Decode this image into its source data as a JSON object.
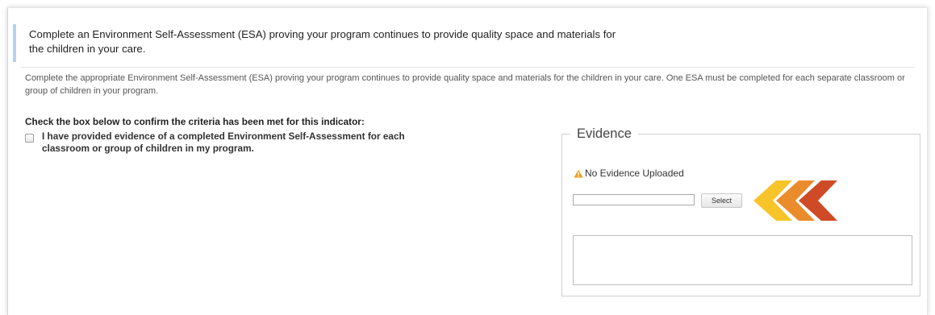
{
  "indicator": {
    "title": "Complete an Environment Self-Assessment (ESA) proving your program continues to provide quality space and materials for the children in your care.",
    "description": "Complete the appropriate Environment Self-Assessment (ESA) proving your program continues to provide quality space and materials for the children in your care. One ESA must be completed for each separate classroom or group of children in your program."
  },
  "criteria": {
    "label": "Check the box below to confirm the criteria has been met for this indicator:",
    "checkbox_label": "I have provided evidence of a completed Environment Self-Assessment for each classroom or group of children in my program.",
    "checked": false
  },
  "evidence": {
    "legend": "Evidence",
    "status": "No Evidence Uploaded",
    "file_value": "",
    "select_label": "Select"
  },
  "colors": {
    "accent_bar": "#b3d4ec",
    "warning": "#f0a020",
    "chevron_yellow": "#f7c52a",
    "chevron_orange": "#ea8c2c",
    "chevron_red": "#cf4a26"
  },
  "icons": {
    "warning": "warning-triangle-icon",
    "arrows": "chevron-left-arrows-icon"
  }
}
